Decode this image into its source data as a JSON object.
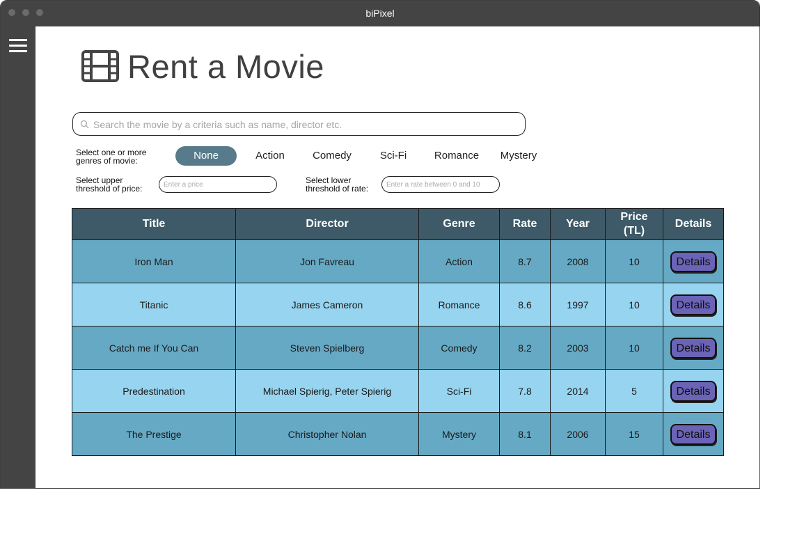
{
  "window": {
    "title": "biPixel"
  },
  "header": {
    "title": "Rent a Movie"
  },
  "search": {
    "placeholder": "Search the movie by a criteria such as name, director etc."
  },
  "genres": {
    "label_line1": "Select one or more",
    "label_line2": "genres of movie:",
    "options": [
      "None",
      "Action",
      "Comedy",
      "Sci-Fi",
      "Romance",
      "Mystery"
    ],
    "selected": "None"
  },
  "price_filter": {
    "label_line1": "Select upper",
    "label_line2": "threshold of price:",
    "placeholder": "Enter a price"
  },
  "rate_filter": {
    "label_line1": "Select lower",
    "label_line2": "threshold of rate:",
    "placeholder": "Enter a rate between 0 and 10"
  },
  "table": {
    "headers": [
      "Title",
      "Director",
      "Genre",
      "Rate",
      "Year",
      "Price (TL)",
      "Details"
    ],
    "button_label": "Details",
    "rows": [
      [
        "Iron Man",
        "Jon Favreau",
        "Action",
        "8.7",
        "2008",
        "10"
      ],
      [
        "Titanic",
        "James Cameron",
        "Romance",
        "8.6",
        "1997",
        "10"
      ],
      [
        "Catch me If You Can",
        "Steven Spielberg",
        "Comedy",
        "8.2",
        "2003",
        "10"
      ],
      [
        "Predestination",
        "Michael Spierig, Peter Spierig",
        "Sci-Fi",
        "7.8",
        "2014",
        "5"
      ],
      [
        "The Prestige",
        "Christopher Nolan",
        "Mystery",
        "8.1",
        "2006",
        "15"
      ]
    ]
  },
  "colors": {
    "chrome": "#444444",
    "table_header": "#3e5a68",
    "row_dark": "#66a9c4",
    "row_light": "#97d4ef",
    "genre_selected": "#577b8b",
    "details_button": "#6a63b6"
  }
}
